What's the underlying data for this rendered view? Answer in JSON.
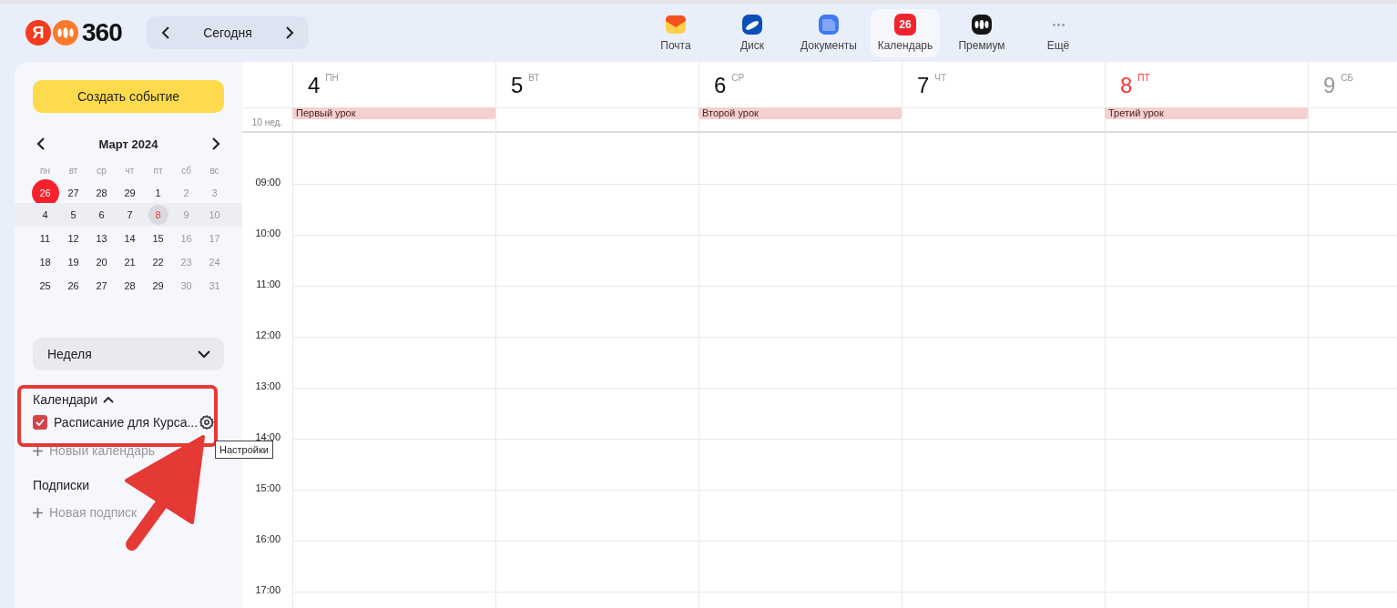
{
  "top_bar": {
    "logo": {
      "letter": "Я",
      "text": "360"
    },
    "today_button": "Сегодня",
    "apps": [
      {
        "label": "Почта",
        "kind": "mail",
        "selected": false
      },
      {
        "label": "Диск",
        "kind": "disk",
        "selected": false
      },
      {
        "label": "Документы",
        "kind": "docs",
        "selected": false
      },
      {
        "label": "Календарь",
        "kind": "calendar",
        "badge": "26",
        "selected": true
      },
      {
        "label": "Премиум",
        "kind": "premium",
        "selected": false
      },
      {
        "label": "Ещё",
        "kind": "more",
        "selected": false
      }
    ]
  },
  "sidebar": {
    "create_button": "Создать событие",
    "mini_calendar": {
      "title": "Март 2024",
      "weekdays": [
        "пн",
        "вт",
        "ср",
        "чт",
        "пт",
        "сб",
        "вс"
      ],
      "weeks": [
        {
          "days": [
            {
              "label": "26",
              "kind": "today"
            },
            {
              "label": "27",
              "kind": "normal"
            },
            {
              "label": "28",
              "kind": "normal"
            },
            {
              "label": "29",
              "kind": "normal"
            },
            {
              "label": "1",
              "kind": "normal"
            },
            {
              "label": "2",
              "kind": "normal"
            },
            {
              "label": "3",
              "kind": "normal"
            }
          ]
        },
        {
          "days": [
            {
              "label": "4",
              "kind": "normal"
            },
            {
              "label": "5",
              "kind": "normal"
            },
            {
              "label": "6",
              "kind": "normal"
            },
            {
              "label": "7",
              "kind": "normal"
            },
            {
              "label": "8",
              "kind": "holiday_selected"
            },
            {
              "label": "9",
              "kind": "normal"
            },
            {
              "label": "10",
              "kind": "normal"
            }
          ]
        },
        {
          "days": [
            {
              "label": "11",
              "kind": "normal"
            },
            {
              "label": "12",
              "kind": "normal"
            },
            {
              "label": "13",
              "kind": "normal"
            },
            {
              "label": "14",
              "kind": "normal"
            },
            {
              "label": "15",
              "kind": "normal"
            },
            {
              "label": "16",
              "kind": "normal"
            },
            {
              "label": "17",
              "kind": "normal"
            }
          ]
        },
        {
          "days": [
            {
              "label": "18",
              "kind": "normal"
            },
            {
              "label": "19",
              "kind": "normal"
            },
            {
              "label": "20",
              "kind": "normal"
            },
            {
              "label": "21",
              "kind": "normal"
            },
            {
              "label": "22",
              "kind": "normal"
            },
            {
              "label": "23",
              "kind": "normal"
            },
            {
              "label": "24",
              "kind": "normal"
            }
          ]
        },
        {
          "days": [
            {
              "label": "25",
              "kind": "normal"
            },
            {
              "label": "26",
              "kind": "normal"
            },
            {
              "label": "27",
              "kind": "normal"
            },
            {
              "label": "28",
              "kind": "normal"
            },
            {
              "label": "29",
              "kind": "normal"
            },
            {
              "label": "30",
              "kind": "normal"
            },
            {
              "label": "31",
              "kind": "normal"
            }
          ]
        }
      ]
    },
    "view_select": {
      "value": "Неделя"
    },
    "calendars": {
      "title": "Календари",
      "expanded": true,
      "items": [
        {
          "name": "Расписание для Курса...",
          "checked": true,
          "color": "#d6434b"
        }
      ],
      "new_item": "Новый календарь"
    },
    "subscriptions": {
      "title": "Подписки",
      "new_item": "Новая подписк"
    }
  },
  "week": {
    "week_label": "10 нед.",
    "days": [
      {
        "number": "4",
        "weekday": "ПН",
        "kind": "normal",
        "event": "Первый урок"
      },
      {
        "number": "5",
        "weekday": "ВТ",
        "kind": "normal"
      },
      {
        "number": "6",
        "weekday": "СР",
        "kind": "normal",
        "event": "Второй урок"
      },
      {
        "number": "7",
        "weekday": "ЧТ",
        "kind": "normal"
      },
      {
        "number": "8",
        "weekday": "ПТ",
        "kind": "holiday",
        "event": "Третий урок"
      },
      {
        "number": "9",
        "weekday": "СБ",
        "kind": "weekend"
      }
    ],
    "hours": [
      "09:00",
      "10:00",
      "11:00",
      "12:00",
      "13:00",
      "14:00",
      "15:00",
      "16:00",
      "17:00"
    ]
  },
  "tooltip": "Настройки"
}
